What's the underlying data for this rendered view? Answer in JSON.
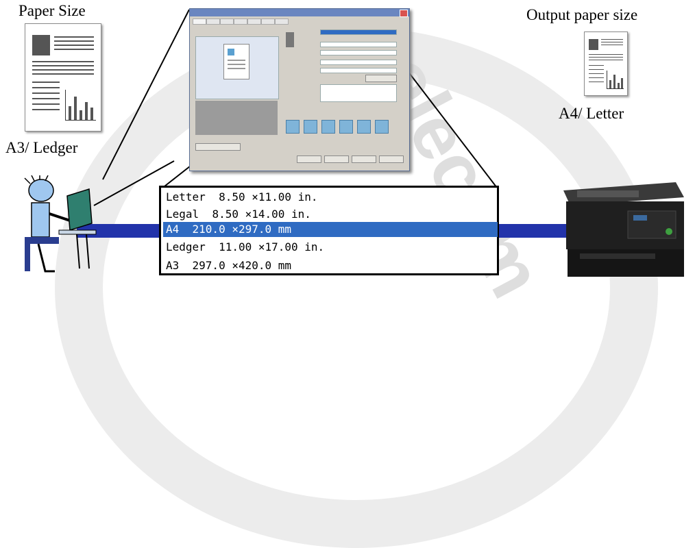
{
  "captions": {
    "paper_size": "Paper Size",
    "input_size": "A3/ Ledger",
    "output_paper_size": "Output paper size",
    "output_size": "A4/ Letter"
  },
  "paper_size_list": {
    "items": [
      {
        "name": "Letter",
        "dims": "8.50 ×11.00 in."
      },
      {
        "name": "Legal",
        "dims": "8.50 ×14.00 in."
      },
      {
        "name": "A4",
        "dims": "210.0 ×297.0 mm"
      },
      {
        "name": "Ledger",
        "dims": "11.00 ×17.00 in."
      },
      {
        "name": "A3",
        "dims": "297.0 ×420.0 mm"
      }
    ],
    "selected": "A4"
  },
  "colors": {
    "network_line": "#2233aa",
    "selection": "#2f6bc2"
  }
}
